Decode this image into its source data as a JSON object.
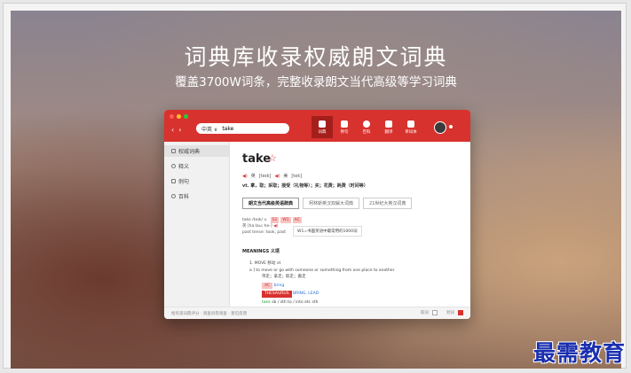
{
  "hero": {
    "title": "词典库收录权威朗文词典",
    "subtitle": "覆盖3700W词条，完整收录朗文当代高级等学习词典"
  },
  "app": {
    "colors": {
      "brand": "#d8322e",
      "active_tab": "#a41f1c",
      "link": "#2a6fd6"
    },
    "nav": {
      "back_icon": "chevron-left-icon",
      "forward_icon": "chevron-right-icon"
    },
    "search": {
      "lang": "中英 ∨",
      "value": "take"
    },
    "tabs": [
      {
        "label": "词典",
        "icon": "book-icon"
      },
      {
        "label": "例句",
        "icon": "sentence-icon"
      },
      {
        "label": "百科",
        "icon": "globe-icon"
      },
      {
        "label": "翻译",
        "icon": "translate-icon"
      },
      {
        "label": "单词本",
        "icon": "bookmark-icon"
      }
    ],
    "sidebar": [
      {
        "label": "权威词典"
      },
      {
        "label": "释义"
      },
      {
        "label": "例句"
      },
      {
        "label": "百科"
      }
    ],
    "entry": {
      "word": "take",
      "star": "☆",
      "pron_uk_label": "英",
      "pron_uk": "[teɪk]",
      "pron_us_label": "美",
      "pron_us": "[tek]",
      "definition": "vt. 拿，取；采取；接受（礼物等）；买；花费；耗费（时间等）",
      "dict_tabs": [
        "朗文当代高级英语辞典",
        "柯林斯英汉双解大词典",
        "21世纪大英汉词典"
      ],
      "forms_line1": "take /teɪk/ v.",
      "forms_tags": [
        "S1",
        "W1",
        "AC"
      ],
      "forms_line2": "英 [ha:lau; he-]",
      "forms_line3": "past tense: took, past",
      "freq": "W1=书面英语中最常用的1000词",
      "meanings_label": "MEANINGS 义项",
      "sense_head": "1.    MOVE 移动    vt",
      "sense_def": "a ]  to move or go with someone or something  from one place to another",
      "sense_cn": "带走；拿走；取走；搬走",
      "tag_ac": "AC",
      "syn_bring": "bring",
      "thesaurus": "THESAURUS",
      "syn_bring_lead": "BRING, LEAD",
      "pattern_take": "take",
      "pattern_rest": "sb / sth to / into etc sth"
    },
    "footer": {
      "links": "给有道词典评分  ·  调查问卷调查  ·  意见反馈",
      "opt1": "取词",
      "opt2": "划词"
    }
  },
  "watermark": "最需教育"
}
